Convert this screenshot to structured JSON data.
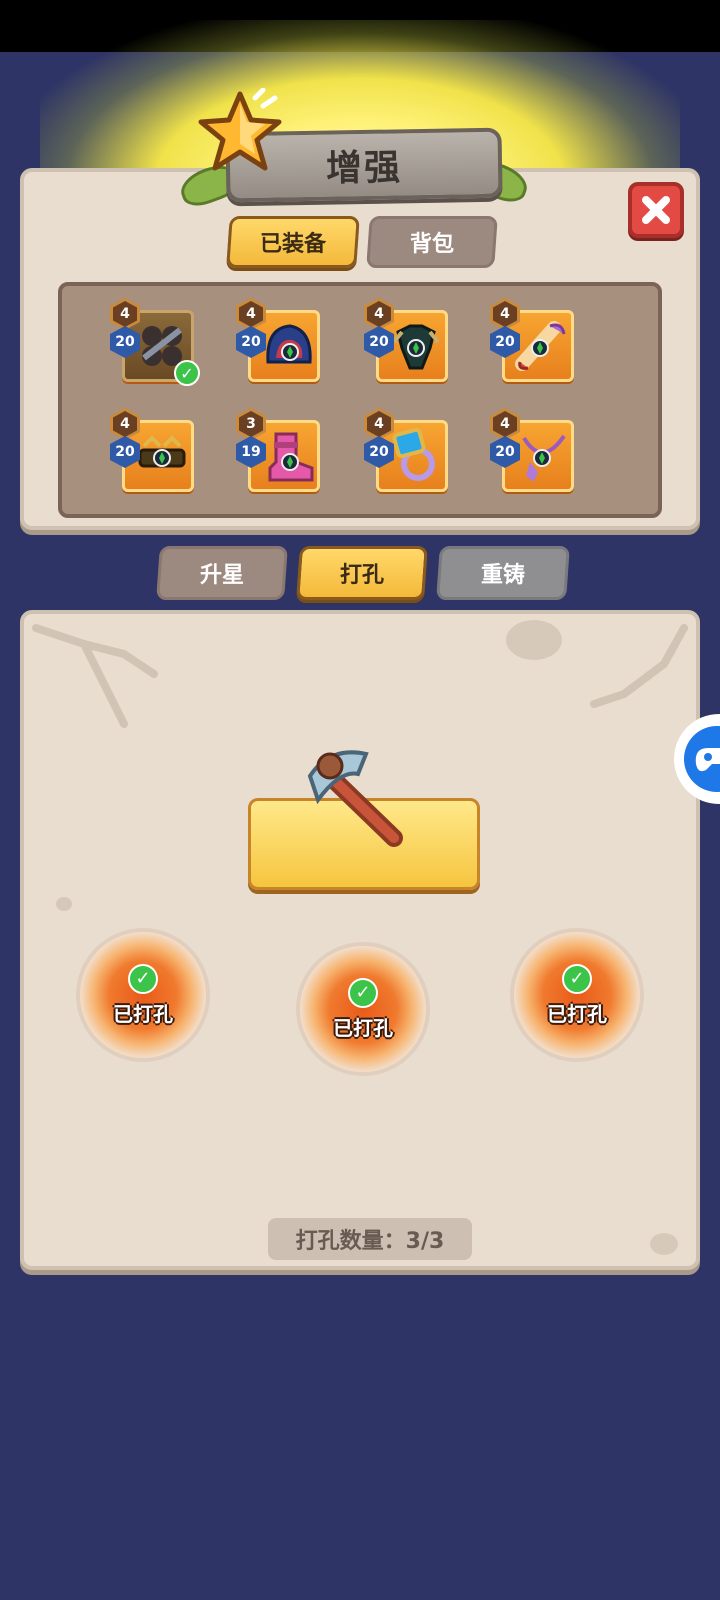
{
  "header": {
    "title": "增强"
  },
  "tabs": {
    "equipped": "已装备",
    "backpack": "背包"
  },
  "items": [
    {
      "stars": "4",
      "level": "20",
      "name": "axe-weapon-icon",
      "equipped": true
    },
    {
      "stars": "4",
      "level": "20",
      "name": "helmet-icon"
    },
    {
      "stars": "4",
      "level": "20",
      "name": "armor-icon"
    },
    {
      "stars": "4",
      "level": "20",
      "name": "scroll-icon"
    },
    {
      "stars": "4",
      "level": "20",
      "name": "belt-icon"
    },
    {
      "stars": "3",
      "level": "19",
      "name": "boots-icon"
    },
    {
      "stars": "4",
      "level": "20",
      "name": "ring-icon"
    },
    {
      "stars": "4",
      "level": "20",
      "name": "necklace-icon"
    }
  ],
  "actions": {
    "upgrade_star": "升星",
    "socket": "打孔",
    "reforge": "重铸"
  },
  "sockets": [
    {
      "label": "已打孔"
    },
    {
      "label": "已打孔"
    },
    {
      "label": "已打孔"
    }
  ],
  "socket_count": "打孔数量：3/3",
  "colors": {
    "accent": "#f4b93a",
    "panel": "#e9ddd0",
    "background": "#2e3466",
    "close": "#e24a43",
    "success": "#3cc44a"
  }
}
